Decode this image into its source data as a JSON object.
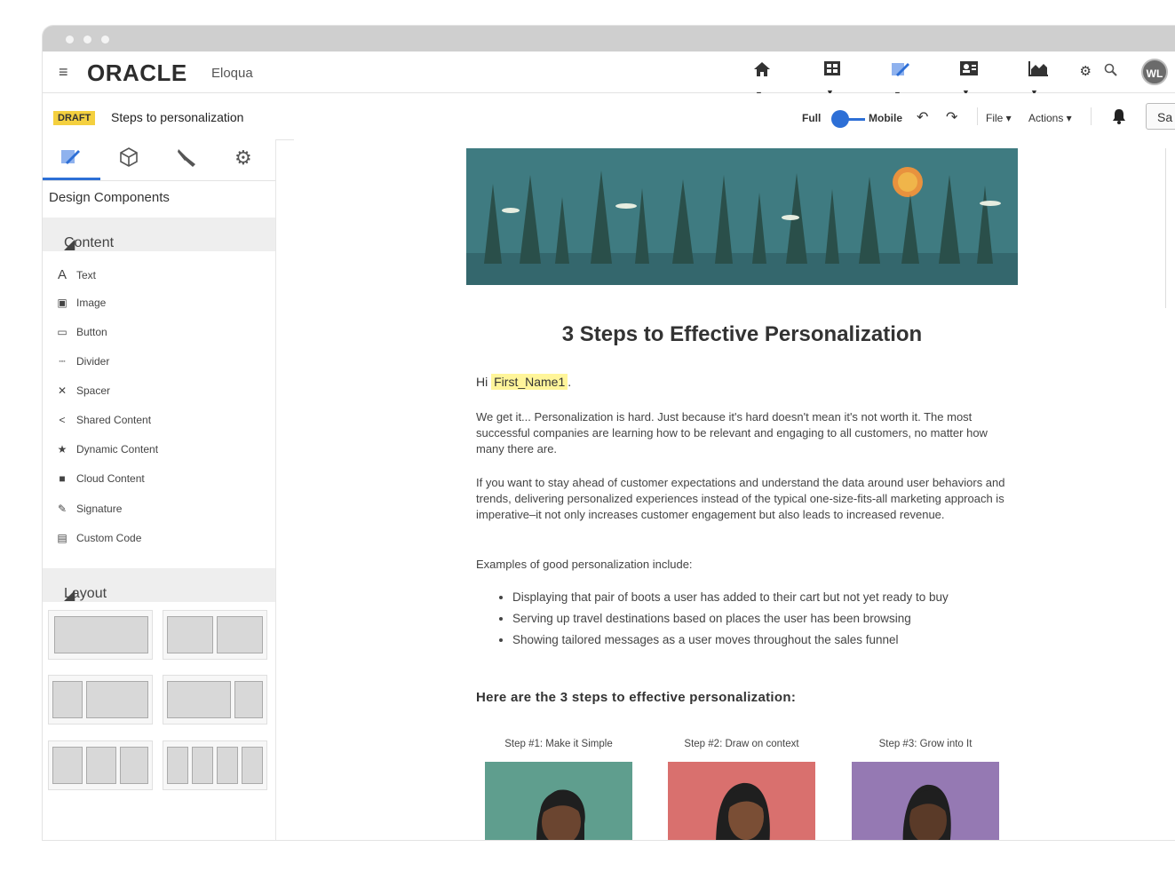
{
  "app": {
    "logo": "ORACLE",
    "logo_sub": "Eloqua",
    "avatar_initials": "WL"
  },
  "toolbar": {
    "status_badge": "DRAFT",
    "doc_title": "Steps to personalization",
    "view_full": "Full",
    "view_mobile": "Mobile",
    "file_menu": "File ▾",
    "actions_menu": "Actions ▾",
    "save_label": "Sa"
  },
  "sidebar": {
    "heading": "Design Components",
    "content_section": "Content",
    "layout_section": "Layout",
    "components": [
      {
        "label": "Text",
        "icon": "text-icon"
      },
      {
        "label": "Image",
        "icon": "image-icon"
      },
      {
        "label": "Button",
        "icon": "button-icon"
      },
      {
        "label": "Divider",
        "icon": "divider-icon"
      },
      {
        "label": "Spacer",
        "icon": "spacer-icon"
      },
      {
        "label": "Shared Content",
        "icon": "share-icon"
      },
      {
        "label": "Dynamic Content",
        "icon": "star-icon"
      },
      {
        "label": "Cloud Content",
        "icon": "cloud-content-icon"
      },
      {
        "label": "Signature",
        "icon": "pen-icon"
      },
      {
        "label": "Custom Code",
        "icon": "code-icon"
      }
    ]
  },
  "email": {
    "title": "3 Steps to Effective Personalization",
    "greeting": "Hi",
    "first_name_token": "First_Name1",
    "greeting_end": ".",
    "para1": "We get it... Personalization is hard. Just because it's hard doesn't mean it's not worth it. The most successful companies are learning how to be relevant and engaging to all customers, no matter how many there are.",
    "para2": "If you want to stay ahead of customer expectations and understand the data around user behaviors and trends, delivering personalized experiences instead of the typical one-size-fits-all marketing approach is imperative–it not only increases customer engagement but also leads to increased revenue.",
    "para3": "Examples of good personalization include:",
    "bullets": [
      "Displaying that pair of boots a user has added to their cart but not yet ready to buy",
      "Serving up travel destinations based on places the user has been browsing",
      "Showing tailored messages as a user moves throughout the sales funnel"
    ],
    "steps_heading": "Here are the 3 steps to effective personalization:",
    "steps": [
      {
        "label": "Step #1: Make it Simple",
        "color": "#5f9e8e"
      },
      {
        "label": "Step #2: Draw on context",
        "color": "#d9706e"
      },
      {
        "label": "Step #3: Grow into It",
        "color": "#9579b3"
      }
    ]
  },
  "colors": {
    "accent": "#2d6fd6",
    "draft_badge": "#f4d03f",
    "highlight": "#fff59a",
    "banner": "#3e7a80"
  }
}
